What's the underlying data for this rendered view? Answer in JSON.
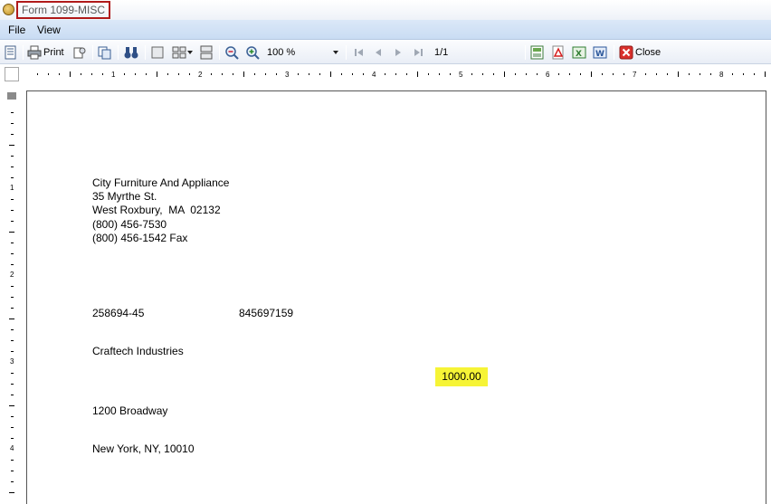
{
  "window": {
    "title": "Form 1099-MISC"
  },
  "menu": {
    "items": [
      "File",
      "View"
    ]
  },
  "toolbar": {
    "print_label": "Print",
    "zoom_value": "100 %",
    "page_indicator": "1/1",
    "close_label": "Close"
  },
  "ruler": {
    "h_numbers": [
      "1",
      "2",
      "3",
      "4",
      "5",
      "6",
      "7",
      "8"
    ],
    "v_numbers": [
      "1",
      "2",
      "3",
      "4"
    ]
  },
  "document": {
    "payer": [
      "City Furniture And Appliance",
      "35 Myrthe St.",
      "West Roxbury,  MA  02132",
      "(800) 456-7530",
      "(800) 456-1542 Fax"
    ],
    "payer_tin": "258694-45",
    "recipient_tin": "845697159",
    "recipient_name": "Craftech Industries",
    "amount": "1000.00",
    "street": "1200 Broadway",
    "city": "New York, NY, 10010"
  },
  "colors": {
    "title_highlight": "#b01a1a",
    "amount_highlight": "#f6f436"
  }
}
